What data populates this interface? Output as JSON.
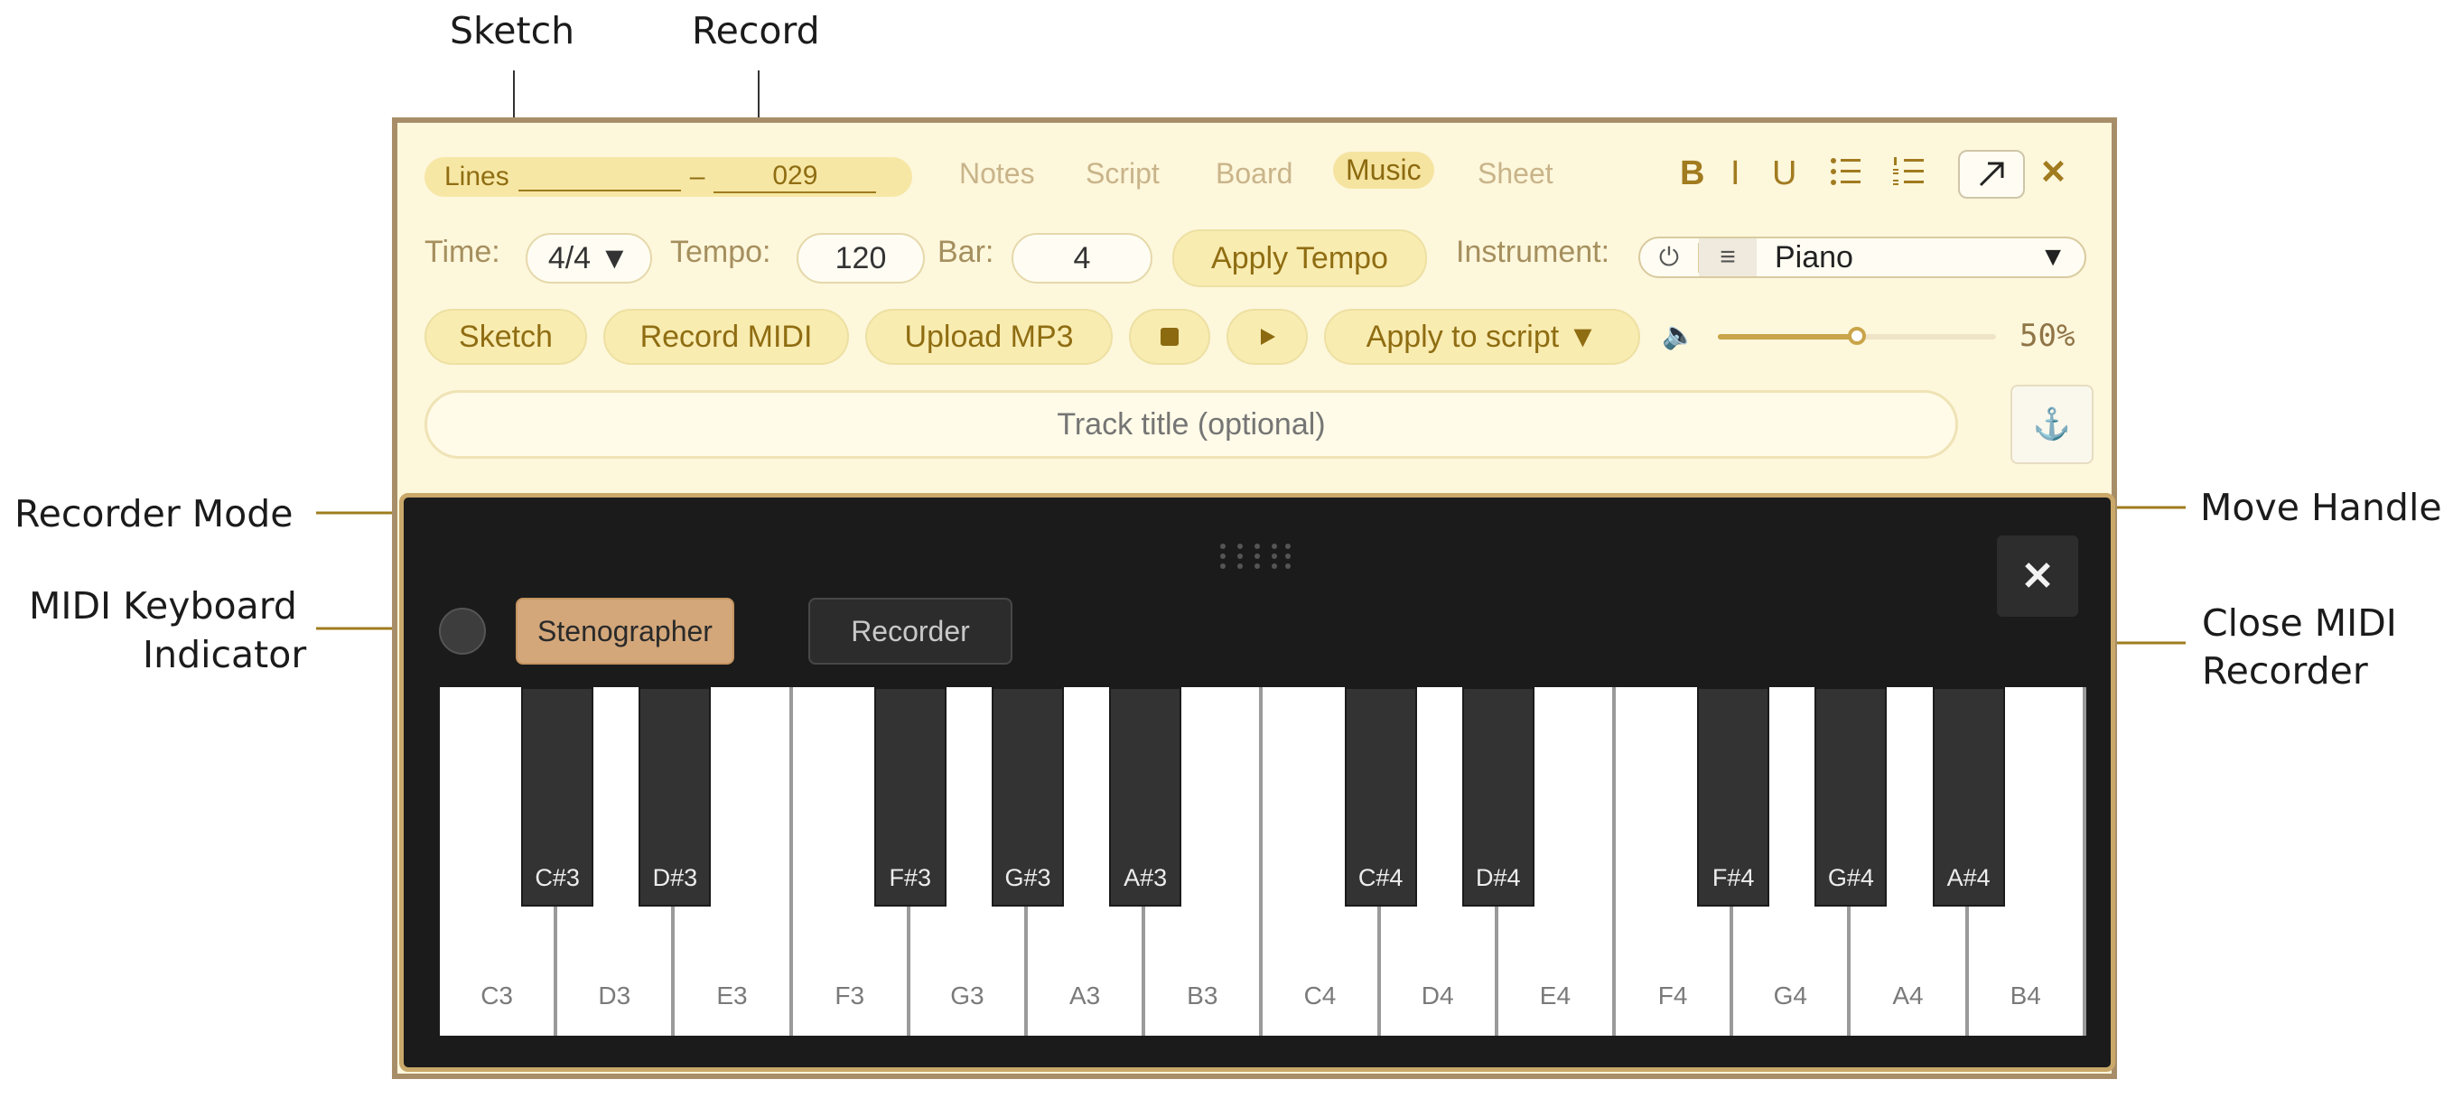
{
  "callouts": {
    "sketch": "Sketch",
    "record": "Record",
    "recorder_mode": "Recorder Mode",
    "midi_indicator_1": "MIDI Keyboard",
    "midi_indicator_2": "Indicator",
    "move_handle": "Move Handle",
    "close_1": "Close MIDI",
    "close_2": "Recorder"
  },
  "toolbar": {
    "lines_label": "Lines",
    "lines_dash": "–",
    "lines_end": "029",
    "tabs": [
      "Notes",
      "Script",
      "Board",
      "Music",
      "Sheet"
    ],
    "active_tab": "Music",
    "format": {
      "bold": "B",
      "italic": "I",
      "underline": "U"
    },
    "close_glyph": "×"
  },
  "music_controls": {
    "time_label": "Time:",
    "time_value": "4/4 ▼",
    "tempo_label": "Tempo:",
    "tempo_value": "120",
    "bar_label": "Bar:",
    "bar_value": "4",
    "apply_tempo": "Apply Tempo",
    "instrument_label": "Instrument:",
    "instrument_value": "Piano",
    "instrument_caret": "▼"
  },
  "actions": {
    "sketch": "Sketch",
    "record_midi": "Record MIDI",
    "upload_mp3": "Upload MP3",
    "apply_to_script": "Apply to script ▼",
    "volume_percent": "50%",
    "volume_level": 0.5
  },
  "track": {
    "title_placeholder": "Track title (optional)",
    "anchor_glyph": "⚓"
  },
  "midi_recorder": {
    "mode_active": "Stenographer",
    "mode_inactive": "Recorder",
    "close_glyph": "✕",
    "white_keys": [
      "C3",
      "D3",
      "E3",
      "F3",
      "G3",
      "A3",
      "B3",
      "C4",
      "D4",
      "E4",
      "F4",
      "G4",
      "A4",
      "B4"
    ],
    "black_keys": [
      "C#3",
      "D#3",
      "F#3",
      "G#3",
      "A#3",
      "C#4",
      "D#4",
      "F#4",
      "G#4",
      "A#4"
    ]
  },
  "colors": {
    "accent_gold": "#b8962e",
    "panel_bg": "#fdf7dc",
    "midi_bg": "#1b1b1b",
    "stenographer_bg": "#d3a77a"
  }
}
